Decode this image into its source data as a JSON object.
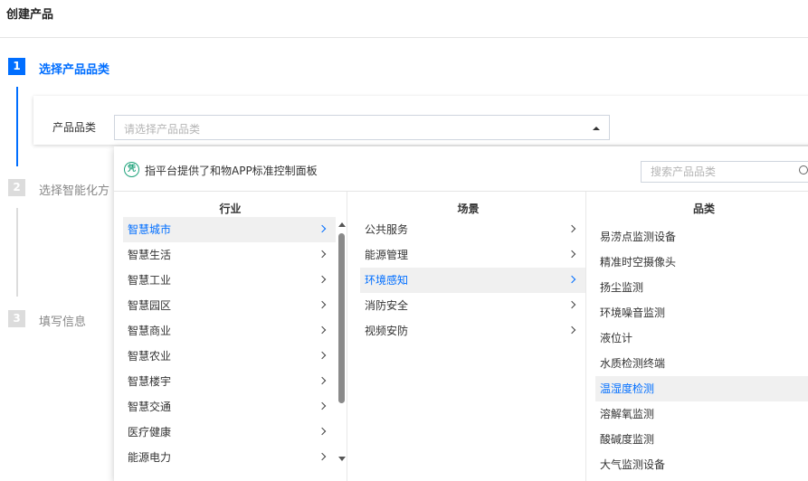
{
  "page": {
    "title": "创建产品"
  },
  "steps": [
    {
      "number": "1",
      "label": "选择产品品类"
    },
    {
      "number": "2",
      "label": "选择智能化方"
    },
    {
      "number": "3",
      "label": "填写信息"
    }
  ],
  "form": {
    "category_label": "产品品类",
    "category_placeholder": "请选择产品品类"
  },
  "dropdown": {
    "badge_text": "凭",
    "notice": "指平台提供了和物APP标准控制面板",
    "search_placeholder": "搜索产品品类",
    "columns": {
      "industry": "行业",
      "scene": "场景",
      "category": "品类"
    },
    "industries": [
      "智慧城市",
      "智慧生活",
      "智慧工业",
      "智慧园区",
      "智慧商业",
      "智慧农业",
      "智慧楼宇",
      "智慧交通",
      "医疗健康",
      "能源电力"
    ],
    "scenes": [
      "公共服务",
      "能源管理",
      "环境感知",
      "消防安全",
      "视频安防"
    ],
    "categories": [
      "易涝点监测设备",
      "精准时空摄像头",
      "扬尘监测",
      "环境噪音监测",
      "液位计",
      "水质检测终端",
      "温湿度检测",
      "溶解氧监测",
      "酸碱度监测",
      "大气监测设备"
    ],
    "selected_industry": "智慧城市",
    "selected_scene": "环境感知",
    "highlighted_category": "温湿度检测"
  },
  "colors": {
    "accent": "#006eff",
    "step_inactive": "#dcdcdc",
    "badge": "#1fa37b",
    "row_highlight": "#f0f0f0"
  }
}
